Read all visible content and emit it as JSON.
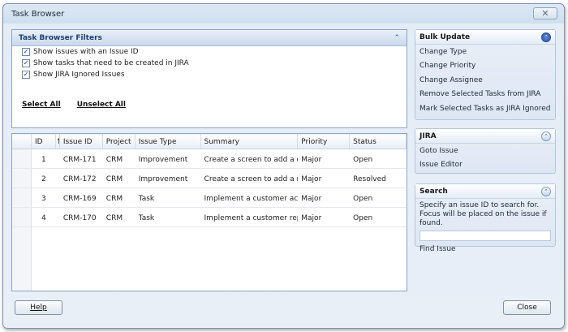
{
  "window": {
    "title": "Task Browser",
    "close_glyph": "✕"
  },
  "filters": {
    "title": "Task Browser Filters",
    "collapse_glyph": "⌃",
    "options": [
      {
        "label": "Show issues with an Issue ID",
        "checked": true
      },
      {
        "label": "Show tasks that need to be created in JIRA",
        "checked": true
      },
      {
        "label": "Show JIRA Ignored Issues",
        "checked": true
      }
    ],
    "select_all": "Select All",
    "unselect_all": "Unselect All"
  },
  "grid": {
    "columns": [
      "ID",
      "↑",
      "Issue ID",
      "Project",
      "Issue Type",
      "Summary",
      "Priority",
      "Status"
    ],
    "rows": [
      {
        "id": "1",
        "issue_id": "CRM-171",
        "project": "CRM",
        "type": "Improvement",
        "summary": "Create a screen to add a c...",
        "priority": "Major",
        "status": "Open"
      },
      {
        "id": "2",
        "issue_id": "CRM-172",
        "project": "CRM",
        "type": "Improvement",
        "summary": "Create a screen to add a n...",
        "priority": "Major",
        "status": "Resolved"
      },
      {
        "id": "3",
        "issue_id": "CRM-169",
        "project": "CRM",
        "type": "Task",
        "summary": "Implement a customer acti...",
        "priority": "Major",
        "status": "Open"
      },
      {
        "id": "4",
        "issue_id": "CRM-170",
        "project": "CRM",
        "type": "Task",
        "summary": "Implement a customer report",
        "priority": "Major",
        "status": "Open"
      }
    ]
  },
  "bulk_update": {
    "title": "Bulk Update",
    "toggle_glyph": "⌃",
    "items": [
      "Change Type",
      "Change Priority",
      "Change Assignee",
      "Remove Selected Tasks from JIRA",
      "Mark Selected Tasks as JIRA Ignored"
    ]
  },
  "jira": {
    "title": "JIRA",
    "toggle_glyph": "⌃",
    "items": [
      "Goto Issue",
      "Issue Editor"
    ]
  },
  "search": {
    "title": "Search",
    "toggle_glyph": "⌃",
    "description": "Specify an issue ID to search for. Focus will be placed on the issue if found.",
    "input_value": "",
    "find_label": "Find Issue"
  },
  "footer": {
    "help": "Help",
    "close": "Close"
  },
  "colors": {
    "accent": "#1f3f72",
    "border": "#8aa4c6",
    "window_bg": "#e9eff7"
  }
}
